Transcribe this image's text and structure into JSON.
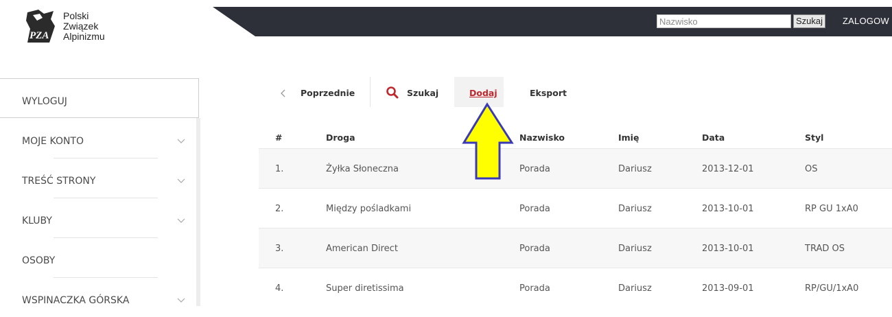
{
  "logo": {
    "lines": [
      "Polski",
      "Związek",
      "Alpinizmu"
    ]
  },
  "topbar": {
    "search_placeholder": "Nazwisko",
    "search_button": "Szukaj",
    "login_label": "ZALOGOW"
  },
  "sidebar": {
    "items": [
      {
        "label": "WYLOGUJ",
        "has_chevron": false,
        "active": true
      },
      {
        "label": "MOJE KONTO",
        "has_chevron": true
      },
      {
        "label": "TREŚĆ STRONY",
        "has_chevron": true
      },
      {
        "label": "KLUBY",
        "has_chevron": true
      },
      {
        "label": "OSOBY",
        "has_chevron": false
      },
      {
        "label": "WSPINACZKA GÓRSKA",
        "has_chevron": true
      }
    ]
  },
  "toolbar": {
    "prev_label": "Poprzednie",
    "search_label": "Szukaj",
    "add_label": "Dodaj",
    "export_label": "Eksport"
  },
  "table": {
    "headers": [
      "#",
      "Droga",
      "Nazwisko",
      "Imię",
      "Data",
      "Styl"
    ],
    "rows": [
      [
        "1.",
        "Żyłka Słoneczna",
        "Porada",
        "Dariusz",
        "2013-12-01",
        "OS"
      ],
      [
        "2.",
        "Między pośladkami",
        "Porada",
        "Dariusz",
        "2013-10-01",
        "RP GU 1xA0"
      ],
      [
        "3.",
        "American Direct",
        "Porada",
        "Dariusz",
        "2013-10-01",
        "TRAD OS"
      ],
      [
        "4.",
        "Super diretissima",
        "Porada",
        "Dariusz",
        "2013-09-01",
        "RP/GU/1xA0"
      ]
    ]
  },
  "colors": {
    "topbar": "#2d3039",
    "accent_red": "#c0272d",
    "arrow_fill": "#ffff00",
    "arrow_stroke": "#3a3ab8"
  }
}
